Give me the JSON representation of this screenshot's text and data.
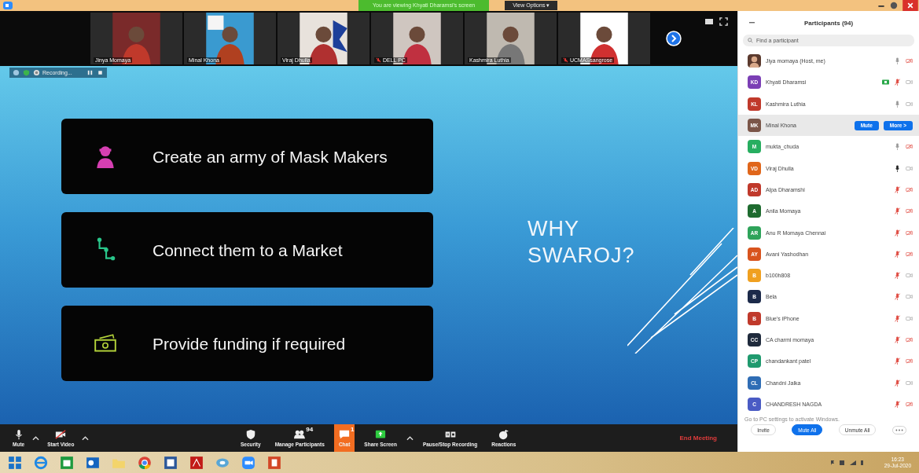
{
  "title_bar": {
    "share_banner": "You are viewing Khyati Dharamsi's screen",
    "view_options": "View Options ▾"
  },
  "thumbnails": [
    {
      "name": "Jinya Momaya",
      "muted": false
    },
    {
      "name": "Minal Khona",
      "muted": false
    },
    {
      "name": "Viraj Dhulla",
      "muted": false
    },
    {
      "name": "DELL PC",
      "muted": true
    },
    {
      "name": "Kashmira Luthia",
      "muted": false
    },
    {
      "name": "UCMASsangrose",
      "muted": true
    }
  ],
  "recording": {
    "label": "Recording..."
  },
  "slide": {
    "cards": [
      {
        "kind": "worker",
        "text": "Create an army of Mask Makers"
      },
      {
        "kind": "connect",
        "text": "Connect them to a Market"
      },
      {
        "kind": "money",
        "text": "Provide funding if required"
      }
    ],
    "heading": "WHY SWAROJ?"
  },
  "toolbar": {
    "left": [
      {
        "kind": "mic",
        "label": "Mute"
      },
      {
        "kind": "video",
        "label": "Start Video"
      }
    ],
    "center": [
      {
        "kind": "security",
        "label": "Security",
        "selected": false
      },
      {
        "kind": "participants",
        "label": "Manage Participants",
        "badge": "94",
        "selected": false
      },
      {
        "kind": "chat",
        "label": "Chat",
        "badge": "1",
        "selected": true
      },
      {
        "kind": "share",
        "label": "Share Screen",
        "selected": false
      },
      {
        "kind": "record",
        "label": "Pause/Stop Recording",
        "selected": false
      },
      {
        "kind": "reactions",
        "label": "Reactions",
        "selected": false
      }
    ],
    "end": "End Meeting"
  },
  "participants": {
    "title": "Participants (94)",
    "placeholder": "Find a participant",
    "rows": [
      {
        "name": "Jiya momaya (Host, me)",
        "mic_muted": false,
        "speaking": false,
        "video_muted": true,
        "sharing": false,
        "selected": false
      },
      {
        "name": "Khyati Dharamsi",
        "initials": "KD",
        "color": "#7b3fb5",
        "mic_muted": true,
        "speaking": false,
        "video_muted": false,
        "sharing": true,
        "selected": false
      },
      {
        "name": "Kashmira Luthia",
        "initials": "KL",
        "color": "#c0392b",
        "mic_muted": false,
        "speaking": false,
        "video_muted": false,
        "sharing": false,
        "selected": false
      },
      {
        "name": "Minal Khona",
        "initials": "MK",
        "color": "#7a5548",
        "actions": [
          "Mute",
          "More >"
        ],
        "sharing": false,
        "selected": true
      },
      {
        "name": "mukta_chuda",
        "initials": "M",
        "color": "#27ae60",
        "mic_muted": false,
        "speaking": false,
        "video_muted": true,
        "sharing": false,
        "selected": false
      },
      {
        "name": "Viraj Dhulla",
        "initials": "VD",
        "color": "#e0661b",
        "mic_muted": false,
        "speaking": true,
        "video_muted": false,
        "sharing": false,
        "selected": false
      },
      {
        "name": "Alpa Dharamshi",
        "initials": "AD",
        "color": "#c0392b",
        "mic_muted": true,
        "speaking": false,
        "video_muted": true,
        "sharing": false,
        "selected": false
      },
      {
        "name": "Anila Momaya",
        "initials": "A",
        "color": "#1e6b2f",
        "mic_muted": true,
        "speaking": false,
        "video_muted": true,
        "sharing": false,
        "selected": false
      },
      {
        "name": "Anu R Momaya Chennai",
        "initials": "AR",
        "color": "#2ea35a",
        "mic_muted": true,
        "speaking": false,
        "video_muted": true,
        "sharing": false,
        "selected": false
      },
      {
        "name": "Avani Yashodhan",
        "initials": "AY",
        "color": "#d8541e",
        "mic_muted": true,
        "speaking": false,
        "video_muted": true,
        "sharing": false,
        "selected": false
      },
      {
        "name": "b100h808",
        "initials": "B",
        "color": "#f0a020",
        "mic_muted": true,
        "speaking": false,
        "video_muted": false,
        "sharing": false,
        "selected": false
      },
      {
        "name": "Bela",
        "initials": "B",
        "color": "#1c2a4a",
        "mic_muted": true,
        "speaking": false,
        "video_muted": false,
        "sharing": false,
        "selected": false
      },
      {
        "name": "Blue's iPhone",
        "initials": "B",
        "color": "#c0392b",
        "mic_muted": true,
        "speaking": false,
        "video_muted": false,
        "sharing": false,
        "selected": false
      },
      {
        "name": "CA charmi momaya",
        "initials": "CC",
        "color": "#1f2a3c",
        "mic_muted": true,
        "speaking": false,
        "video_muted": true,
        "sharing": false,
        "selected": false
      },
      {
        "name": "chandankant patel",
        "initials": "CP",
        "color": "#1f9a6e",
        "mic_muted": true,
        "speaking": false,
        "video_muted": true,
        "sharing": false,
        "selected": false
      },
      {
        "name": "Chandni Jalka",
        "initials": "CL",
        "color": "#2f6db5",
        "mic_muted": true,
        "speaking": false,
        "video_muted": false,
        "sharing": false,
        "selected": false
      },
      {
        "name": "CHANDRESH NAGDA",
        "initials": "C",
        "color": "#4a5bc4",
        "mic_muted": true,
        "speaking": false,
        "video_muted": true,
        "sharing": false,
        "selected": false
      }
    ],
    "activation_notice": "Go to PC settings to activate Windows.",
    "buttons": [
      {
        "label": "Invite",
        "selected": false
      },
      {
        "label": "Mute All",
        "selected": true
      },
      {
        "label": "Unmute All",
        "selected": false
      }
    ]
  },
  "taskbar": {
    "time": "16:23",
    "date": "29-Jul-2020"
  }
}
